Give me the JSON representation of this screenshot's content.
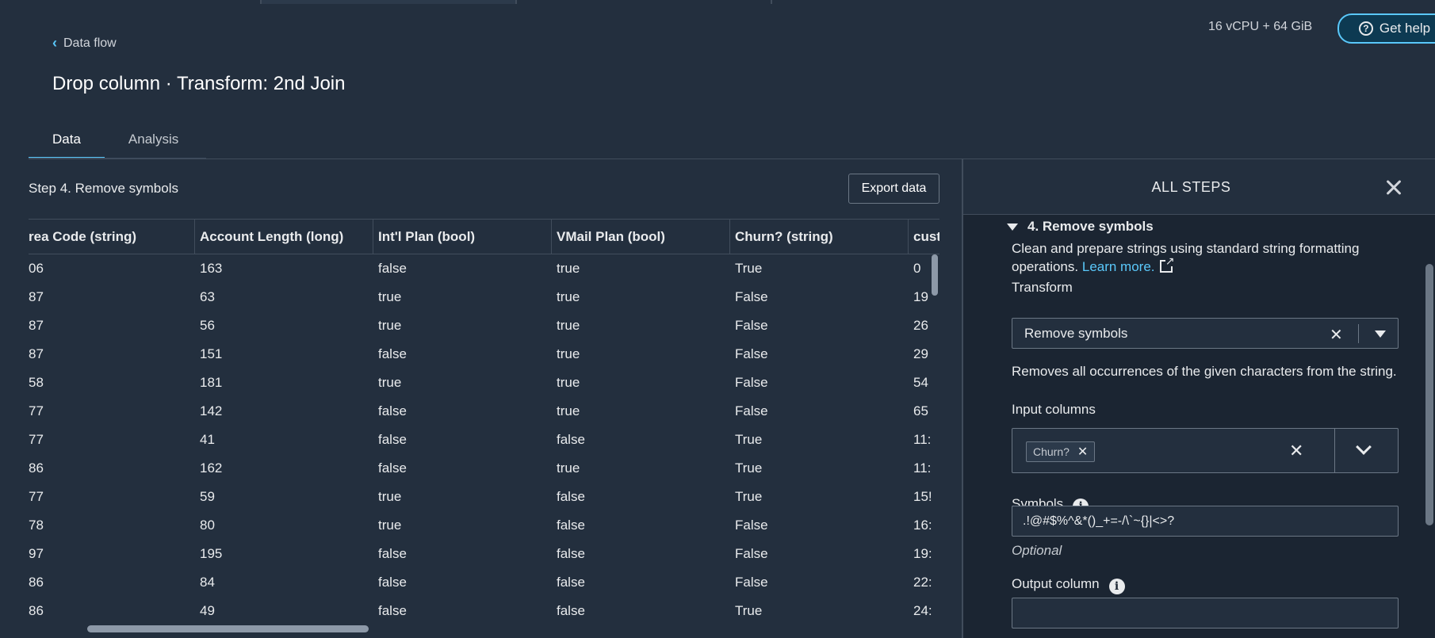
{
  "breadcrumb": {
    "label": "Data flow"
  },
  "page_title": "Drop column · Transform: 2nd Join",
  "resources": "16 vCPU + 64 GiB",
  "help_button": "Get help",
  "tabs": [
    {
      "label": "Data"
    },
    {
      "label": "Analysis"
    }
  ],
  "step_title": "Step 4. Remove symbols",
  "export_button": "Export data",
  "table": {
    "columns": [
      "rea Code (string)",
      "Account Length (long)",
      "Int'l Plan (bool)",
      "VMail Plan (bool)",
      "Churn? (string)",
      "cust"
    ],
    "rows": [
      [
        "06",
        "163",
        "false",
        "true",
        "True",
        "0"
      ],
      [
        "87",
        "63",
        "true",
        "true",
        "False",
        "19"
      ],
      [
        "87",
        "56",
        "true",
        "true",
        "False",
        "26"
      ],
      [
        "87",
        "151",
        "false",
        "true",
        "False",
        "29"
      ],
      [
        "58",
        "181",
        "true",
        "true",
        "False",
        "54"
      ],
      [
        "77",
        "142",
        "false",
        "true",
        "False",
        "65"
      ],
      [
        "77",
        "41",
        "false",
        "false",
        "True",
        "11:"
      ],
      [
        "86",
        "162",
        "false",
        "true",
        "True",
        "11:"
      ],
      [
        "77",
        "59",
        "true",
        "false",
        "True",
        "15!"
      ],
      [
        "78",
        "80",
        "true",
        "false",
        "False",
        "16:"
      ],
      [
        "97",
        "195",
        "false",
        "false",
        "False",
        "19:"
      ],
      [
        "86",
        "84",
        "false",
        "false",
        "False",
        "22:"
      ],
      [
        "86",
        "49",
        "false",
        "false",
        "True",
        "24:"
      ]
    ]
  },
  "panel": {
    "title": "ALL STEPS",
    "section_title": "4. Remove symbols",
    "description": "Clean and prepare strings using standard string formatting operations.",
    "learn_more": "Learn more.",
    "transform_label": "Transform",
    "transform_value": "Remove symbols",
    "transform_hint": "Removes all occurrences of the given characters from the string.",
    "input_columns_label": "Input columns",
    "input_column_chip": "Churn?",
    "symbols_label": "Symbols",
    "symbols_value": ".!@#$%^&*()_+=-/\\`~{}|<>?",
    "optional": "Optional",
    "output_column_label": "Output column",
    "output_column_value": ""
  }
}
